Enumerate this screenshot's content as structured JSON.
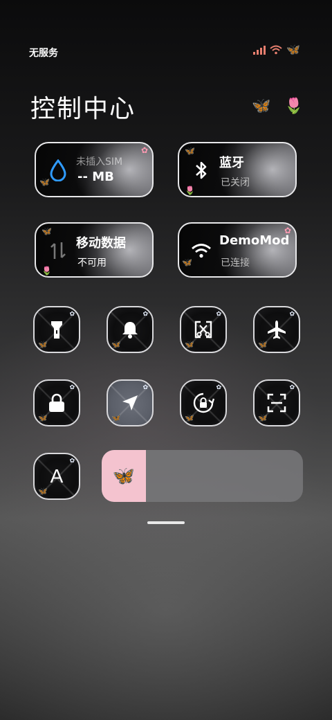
{
  "status": {
    "carrier": "无服务",
    "icons": [
      "signal-bars-icon",
      "wifi-icon",
      "butterfly-icon"
    ]
  },
  "header": {
    "title": "控制中心",
    "icons": [
      "butterfly-icon",
      "tulip-icon"
    ],
    "butterfly_glyph": "🦋",
    "tulip_glyph": "🌷"
  },
  "tiles": [
    {
      "id": "data",
      "label": "未插入SIM",
      "value": "-- MB",
      "icon": "drop-icon"
    },
    {
      "id": "bluetooth",
      "label": "蓝牙",
      "value": "已关闭",
      "icon": "bluetooth-icon"
    },
    {
      "id": "mobile-data",
      "label": "移动数据",
      "value": "不可用",
      "icon": "mobile-data-icon"
    },
    {
      "id": "wifi",
      "label": "DemoMod",
      "value": "已连接",
      "icon": "wifi-icon"
    }
  ],
  "toggles_row1": [
    "flashlight-icon",
    "bell-icon",
    "screenshot-icon",
    "airplane-icon"
  ],
  "toggles_row2": [
    "lock-icon",
    "location-icon",
    "rotation-lock-icon",
    "scan-icon"
  ],
  "font_button": {
    "label": "A"
  },
  "brightness": {
    "level": 0.22,
    "thumb_icon": "butterfly-icon",
    "thumb_glyph": "🦋"
  },
  "colors": {
    "accent_blue": "#3fa6ff",
    "slider_fill": "#f4c3cf"
  }
}
